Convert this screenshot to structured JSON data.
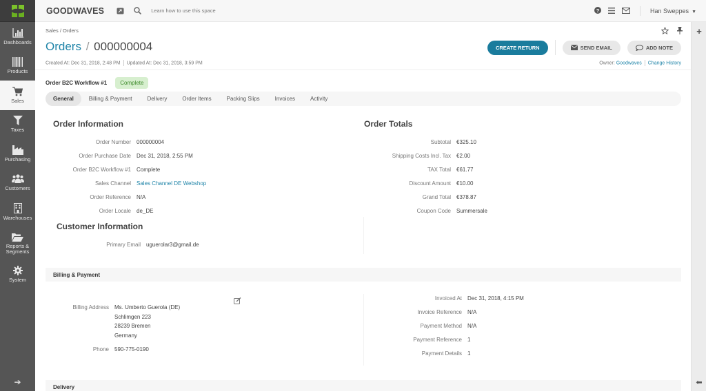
{
  "app": {
    "brand": "GOODWAVES",
    "help_link": "Learn how to use this space",
    "user_name": "Han Sweppes",
    "brand_color": "#1a7c9d",
    "icons": {
      "logo": "four-leaf-logo-icon",
      "screen": "screen-icon",
      "search": "search-icon",
      "help": "help-circle-icon",
      "menu": "list-icon",
      "mail": "mail-icon",
      "star": "star-icon",
      "pin": "pin-icon",
      "plus": "plus-icon",
      "arrow_right": "arrow-right-icon",
      "arrow_left": "arrow-left-icon",
      "edit": "edit-icon"
    }
  },
  "sidebar": {
    "items": [
      {
        "label": "Dashboards",
        "icon": "bar-chart-icon"
      },
      {
        "label": "Products",
        "icon": "barcode-icon"
      },
      {
        "label": "Sales",
        "icon": "cart-icon",
        "active": true
      },
      {
        "label": "Taxes",
        "icon": "filter-icon"
      },
      {
        "label": "Purchasing",
        "icon": "factory-icon"
      },
      {
        "label": "Customers",
        "icon": "users-icon"
      },
      {
        "label": "Warehouses",
        "icon": "building-icon"
      },
      {
        "label": "Reports &",
        "label2": "Segments",
        "icon": "folder-open-icon"
      },
      {
        "label": "System",
        "icon": "gear-icon"
      }
    ]
  },
  "page": {
    "breadcrumb": "Sales / Orders",
    "title_link": "Orders",
    "title_sep": "/",
    "title_id": "000000004",
    "created": "Created At: Dec 31, 2018, 2:48 PM",
    "updated": "Updated At: Dec 31, 2018, 3:59 PM",
    "owner_label": "Owner:",
    "owner_value": "Goodwaves",
    "change_history": "Change History",
    "actions": {
      "create_return": "CREATE RETURN",
      "send_email": "SEND EMAIL",
      "add_note": "ADD NOTE"
    },
    "workflow_label": "Order B2C Workflow #1",
    "workflow_status": "Complete",
    "tabs": [
      "General",
      "Billing & Payment",
      "Delivery",
      "Order Items",
      "Packing Slips",
      "Invoices",
      "Activity"
    ],
    "active_tab": "General"
  },
  "order_information": {
    "title": "Order Information",
    "rows": [
      {
        "k": "Order Number",
        "v": "000000004"
      },
      {
        "k": "Order Purchase Date",
        "v": "Dec 31, 2018, 2:55 PM"
      },
      {
        "k": "Order B2C Workflow #1",
        "v": "Complete"
      },
      {
        "k": "Sales Channel",
        "v": "Sales Channel DE Webshop",
        "link": true
      },
      {
        "k": "Order Reference",
        "v": "N/A"
      },
      {
        "k": "Order Locale",
        "v": "de_DE"
      }
    ]
  },
  "order_totals": {
    "title": "Order Totals",
    "rows": [
      {
        "k": "Subtotal",
        "v": "€325.10"
      },
      {
        "k": "Shipping Costs Incl. Tax",
        "v": "€2.00"
      },
      {
        "k": "TAX Total",
        "v": "€61.77"
      },
      {
        "k": "Discount Amount",
        "v": "€10.00"
      },
      {
        "k": "Grand Total",
        "v": "€378.87"
      },
      {
        "k": "Coupon Code",
        "v": "Summersale"
      }
    ]
  },
  "customer_information": {
    "title": "Customer Information",
    "rows": [
      {
        "k": "Primary Email",
        "v": "uguerolar3@gmail.de"
      }
    ]
  },
  "billing_payment": {
    "title": "Billing & Payment",
    "address_label": "Billing Address",
    "address_lines": [
      "Ms. Umberto Guerola (DE)",
      "Schlimgen 223",
      "28239 Bremen",
      "Germany"
    ],
    "phone_label": "Phone",
    "phone": "590-775-0190",
    "rows": [
      {
        "k": "Invoiced At",
        "v": "Dec 31, 2018, 4:15 PM"
      },
      {
        "k": "Invoice Reference",
        "v": "N/A"
      },
      {
        "k": "Payment Method",
        "v": "N/A"
      },
      {
        "k": "Payment Reference",
        "v": "1"
      },
      {
        "k": "Payment Details",
        "v": "1"
      }
    ]
  },
  "delivery": {
    "title": "Delivery"
  }
}
